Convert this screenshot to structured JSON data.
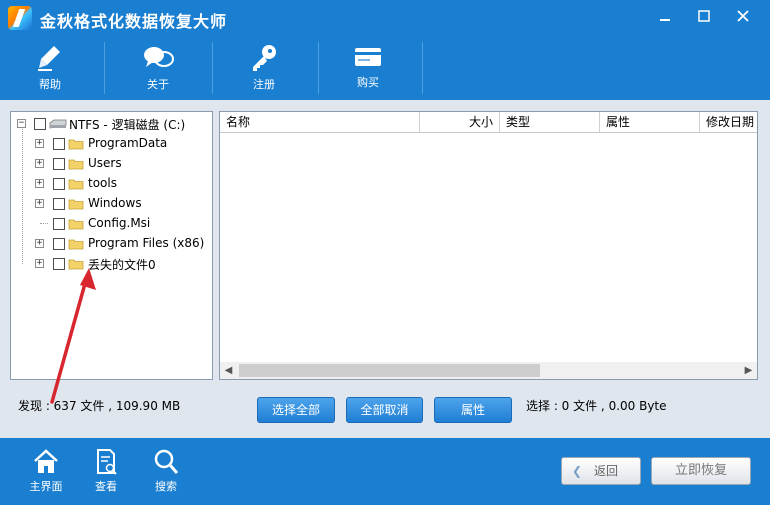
{
  "window": {
    "title": "金秋格式化数据恢复大师"
  },
  "toolbar": {
    "items": [
      {
        "label": "帮助",
        "icon": "pen-icon"
      },
      {
        "label": "关于",
        "icon": "chat-bubbles-icon"
      },
      {
        "label": "注册",
        "icon": "key-icon"
      },
      {
        "label": "购买",
        "icon": "card-icon"
      }
    ]
  },
  "tree": {
    "root": "NTFS - 逻辑磁盘 (C:)",
    "children": [
      {
        "label": "ProgramData",
        "expandable": true
      },
      {
        "label": "Users",
        "expandable": true
      },
      {
        "label": "tools",
        "expandable": true
      },
      {
        "label": "Windows",
        "expandable": true
      },
      {
        "label": "Config.Msi",
        "expandable": false
      },
      {
        "label": "Program Files (x86)",
        "expandable": true
      },
      {
        "label": "丢失的文件0",
        "expandable": true
      }
    ]
  },
  "list": {
    "columns": [
      "名称",
      "大小",
      "类型",
      "属性",
      "修改日期"
    ]
  },
  "status": {
    "found": "发现 : 637 文件 , 109.90 MB",
    "selected": "选择 : 0 文件 , 0.00 Byte"
  },
  "actions": {
    "select_all": "选择全部",
    "deselect_all": "全部取消",
    "properties": "属性"
  },
  "bottom_nav": [
    {
      "label": "主界面",
      "icon": "home-icon"
    },
    {
      "label": "查看",
      "icon": "document-view-icon"
    },
    {
      "label": "搜索",
      "icon": "search-icon"
    }
  ],
  "buttons": {
    "back": "返回",
    "recover": "立即恢复"
  },
  "colors": {
    "brand_blue": "#1a7fd0",
    "annotation_red": "#d8262e"
  }
}
